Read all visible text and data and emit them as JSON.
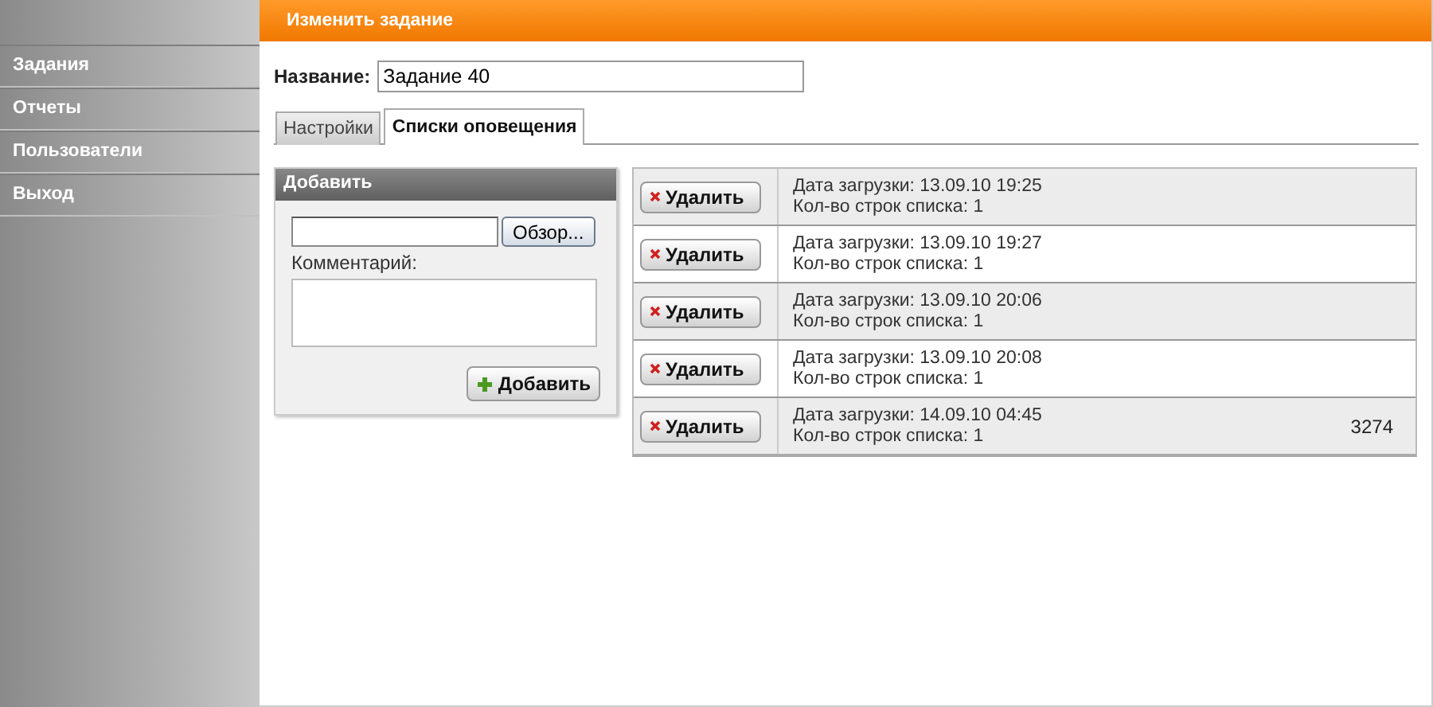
{
  "header": {
    "title": "Изменить задание"
  },
  "sidebar": {
    "items": [
      {
        "label": "Задания",
        "selected": false
      },
      {
        "label": "Отчеты",
        "selected": false
      },
      {
        "label": "Пользователи",
        "selected": false
      },
      {
        "label": "Выход",
        "selected": false
      }
    ]
  },
  "name_field": {
    "label": "Название:",
    "value": "Задание 40"
  },
  "tabs": [
    {
      "label": "Настройки",
      "selected": false
    },
    {
      "label": "Списки оповещения",
      "selected": true
    }
  ],
  "add_panel": {
    "title": "Добавить",
    "browse_button": "Обзор...",
    "comment_label": "Комментарий:",
    "add_button": "Добавить"
  },
  "lists": [
    {
      "delete_button": "Удалить",
      "date": "Дата загрузки: 13.09.10 19:25",
      "count": "Кол-во строк списка: 1"
    },
    {
      "delete_button": "Удалить",
      "date": "Дата загрузки: 13.09.10 19:27",
      "count": "Кол-во строк списка: 1"
    },
    {
      "delete_button": "Удалить",
      "date": "Дата загрузки: 13.09.10 20:06",
      "count": "Кол-во строк списка: 1"
    },
    {
      "delete_button": "Удалить",
      "date": "Дата загрузки: 13.09.10 20:08",
      "count": "Кол-во строк списка: 1"
    },
    {
      "delete_button": "Удалить",
      "date": "Дата загрузки: 14.09.10 04:45",
      "count": "Кол-во строк списка: 1",
      "extra": "3274"
    }
  ]
}
